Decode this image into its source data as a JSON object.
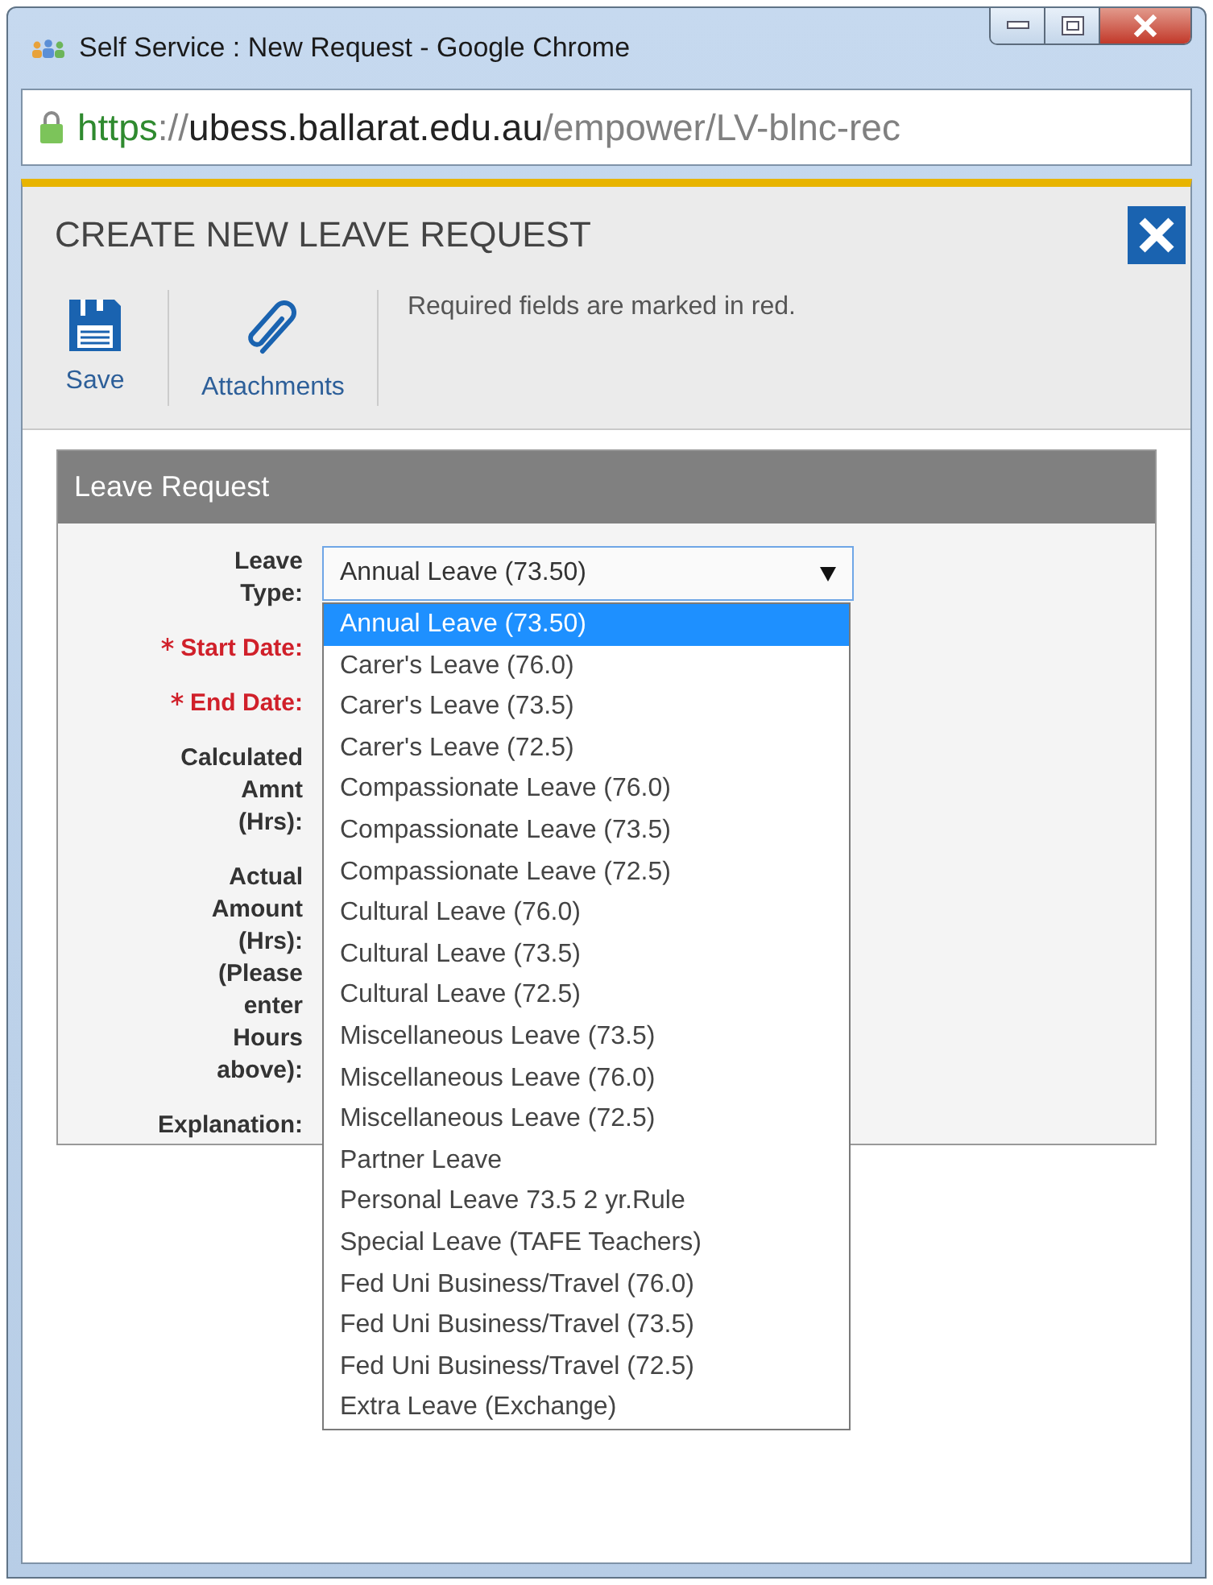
{
  "window": {
    "title": "Self Service : New Request - Google Chrome"
  },
  "address_bar": {
    "scheme": "https",
    "separator": "://",
    "host": "ubess.ballarat.edu.au",
    "path": "/empower/LV-blnc-rec"
  },
  "dialog": {
    "title": "CREATE NEW LEAVE REQUEST",
    "note": "Required fields are marked in red."
  },
  "toolbar": [
    {
      "kind": "save",
      "label": "Save"
    },
    {
      "kind": "attach",
      "label": "Attachments"
    }
  ],
  "panel": {
    "title": "Leave Request"
  },
  "fields": [
    {
      "label": "Leave Type:",
      "required": false
    },
    {
      "label": "Start Date:",
      "required": true
    },
    {
      "label": "End Date:",
      "required": true
    },
    {
      "label": "Calculated Amnt (Hrs):",
      "required": false
    },
    {
      "label": "Actual Amount (Hrs): (Please enter Hours above):",
      "required": false
    },
    {
      "label": "Explanation:",
      "required": false
    }
  ],
  "leave_type": {
    "value": "Annual Leave (73.50)",
    "expanded": true,
    "options": [
      {
        "label": "Annual Leave (73.50)",
        "selected": true
      },
      {
        "label": "Carer's Leave (76.0)",
        "selected": false
      },
      {
        "label": "Carer's Leave (73.5)",
        "selected": false
      },
      {
        "label": "Carer's Leave (72.5)",
        "selected": false
      },
      {
        "label": "Compassionate Leave (76.0)",
        "selected": false
      },
      {
        "label": "Compassionate Leave (73.5)",
        "selected": false
      },
      {
        "label": "Compassionate Leave (72.5)",
        "selected": false
      },
      {
        "label": "Cultural Leave (76.0)",
        "selected": false
      },
      {
        "label": "Cultural Leave (73.5)",
        "selected": false
      },
      {
        "label": "Cultural Leave (72.5)",
        "selected": false
      },
      {
        "label": "Miscellaneous Leave (73.5)",
        "selected": false
      },
      {
        "label": "Miscellaneous Leave (76.0)",
        "selected": false
      },
      {
        "label": "Miscellaneous Leave (72.5)",
        "selected": false
      },
      {
        "label": "Partner Leave",
        "selected": false
      },
      {
        "label": "Personal Leave 73.5 2 yr.Rule",
        "selected": false
      },
      {
        "label": "Special Leave (TAFE Teachers)",
        "selected": false
      },
      {
        "label": "Fed Uni Business/Travel (76.0)",
        "selected": false
      },
      {
        "label": "Fed Uni Business/Travel (73.5)",
        "selected": false
      },
      {
        "label": "Fed Uni Business/Travel (72.5)",
        "selected": false
      },
      {
        "label": "Extra Leave (Exchange)",
        "selected": false
      }
    ]
  }
}
